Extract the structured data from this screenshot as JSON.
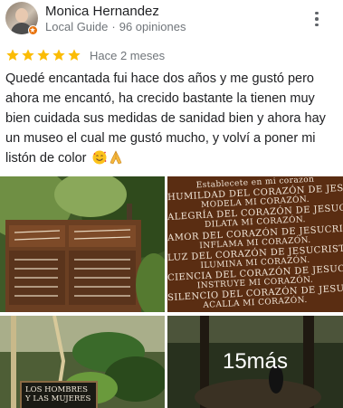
{
  "reviewer": {
    "name": "Monica Hernandez",
    "level": "Local Guide",
    "separator": "·",
    "review_count": "96 opiniones"
  },
  "rating": {
    "stars": 5,
    "max": 5,
    "star_color": "#fbbc04",
    "date": "Hace 2 meses"
  },
  "review": {
    "text": "Quedé encantada fui hace dos años y me gustó pero ahora me encantó, ha crecido bastante la tienen muy bien cuidada sus medidas de sanidad bien y ahora hay un museo el cual me gustó mucho, y volví a poner mi listón de color",
    "emojis": [
      "smiling-face-with-hearts",
      "folded-hands"
    ]
  },
  "photos": {
    "sign_lines": [
      "Establecete en mi corazon",
      "HUMILDAD DEL CORAZÓN DE JESUCRISTO,",
      "MODELA MI CORAZÓN.",
      "ALEGRÍA DEL CORAZÓN DE JESUCRISTO,",
      "DILATA MI CORAZÓN.",
      "AMOR DEL CORAZÓN DE JESUCRISTO,",
      "INFLAMA MI CORAZÓN.",
      "LUZ DEL CORAZÓN DE JESUCRISTO,",
      "ILUMINA MI CORAZÓN.",
      "CIENCIA DEL CORAZÓN DE JESUCRISTO,",
      "INSTRUYE MI CORAZÓN.",
      "SILENCIO DEL CORAZÓN DE JESUCRISTO,",
      "ACALLA MI CORAZÓN."
    ],
    "small_sign": "LOS HOMBRES Y LAS MUJERES",
    "more_label": "15más"
  },
  "colors": {
    "badge": "#e8710a",
    "secondary_text": "#70757a"
  }
}
